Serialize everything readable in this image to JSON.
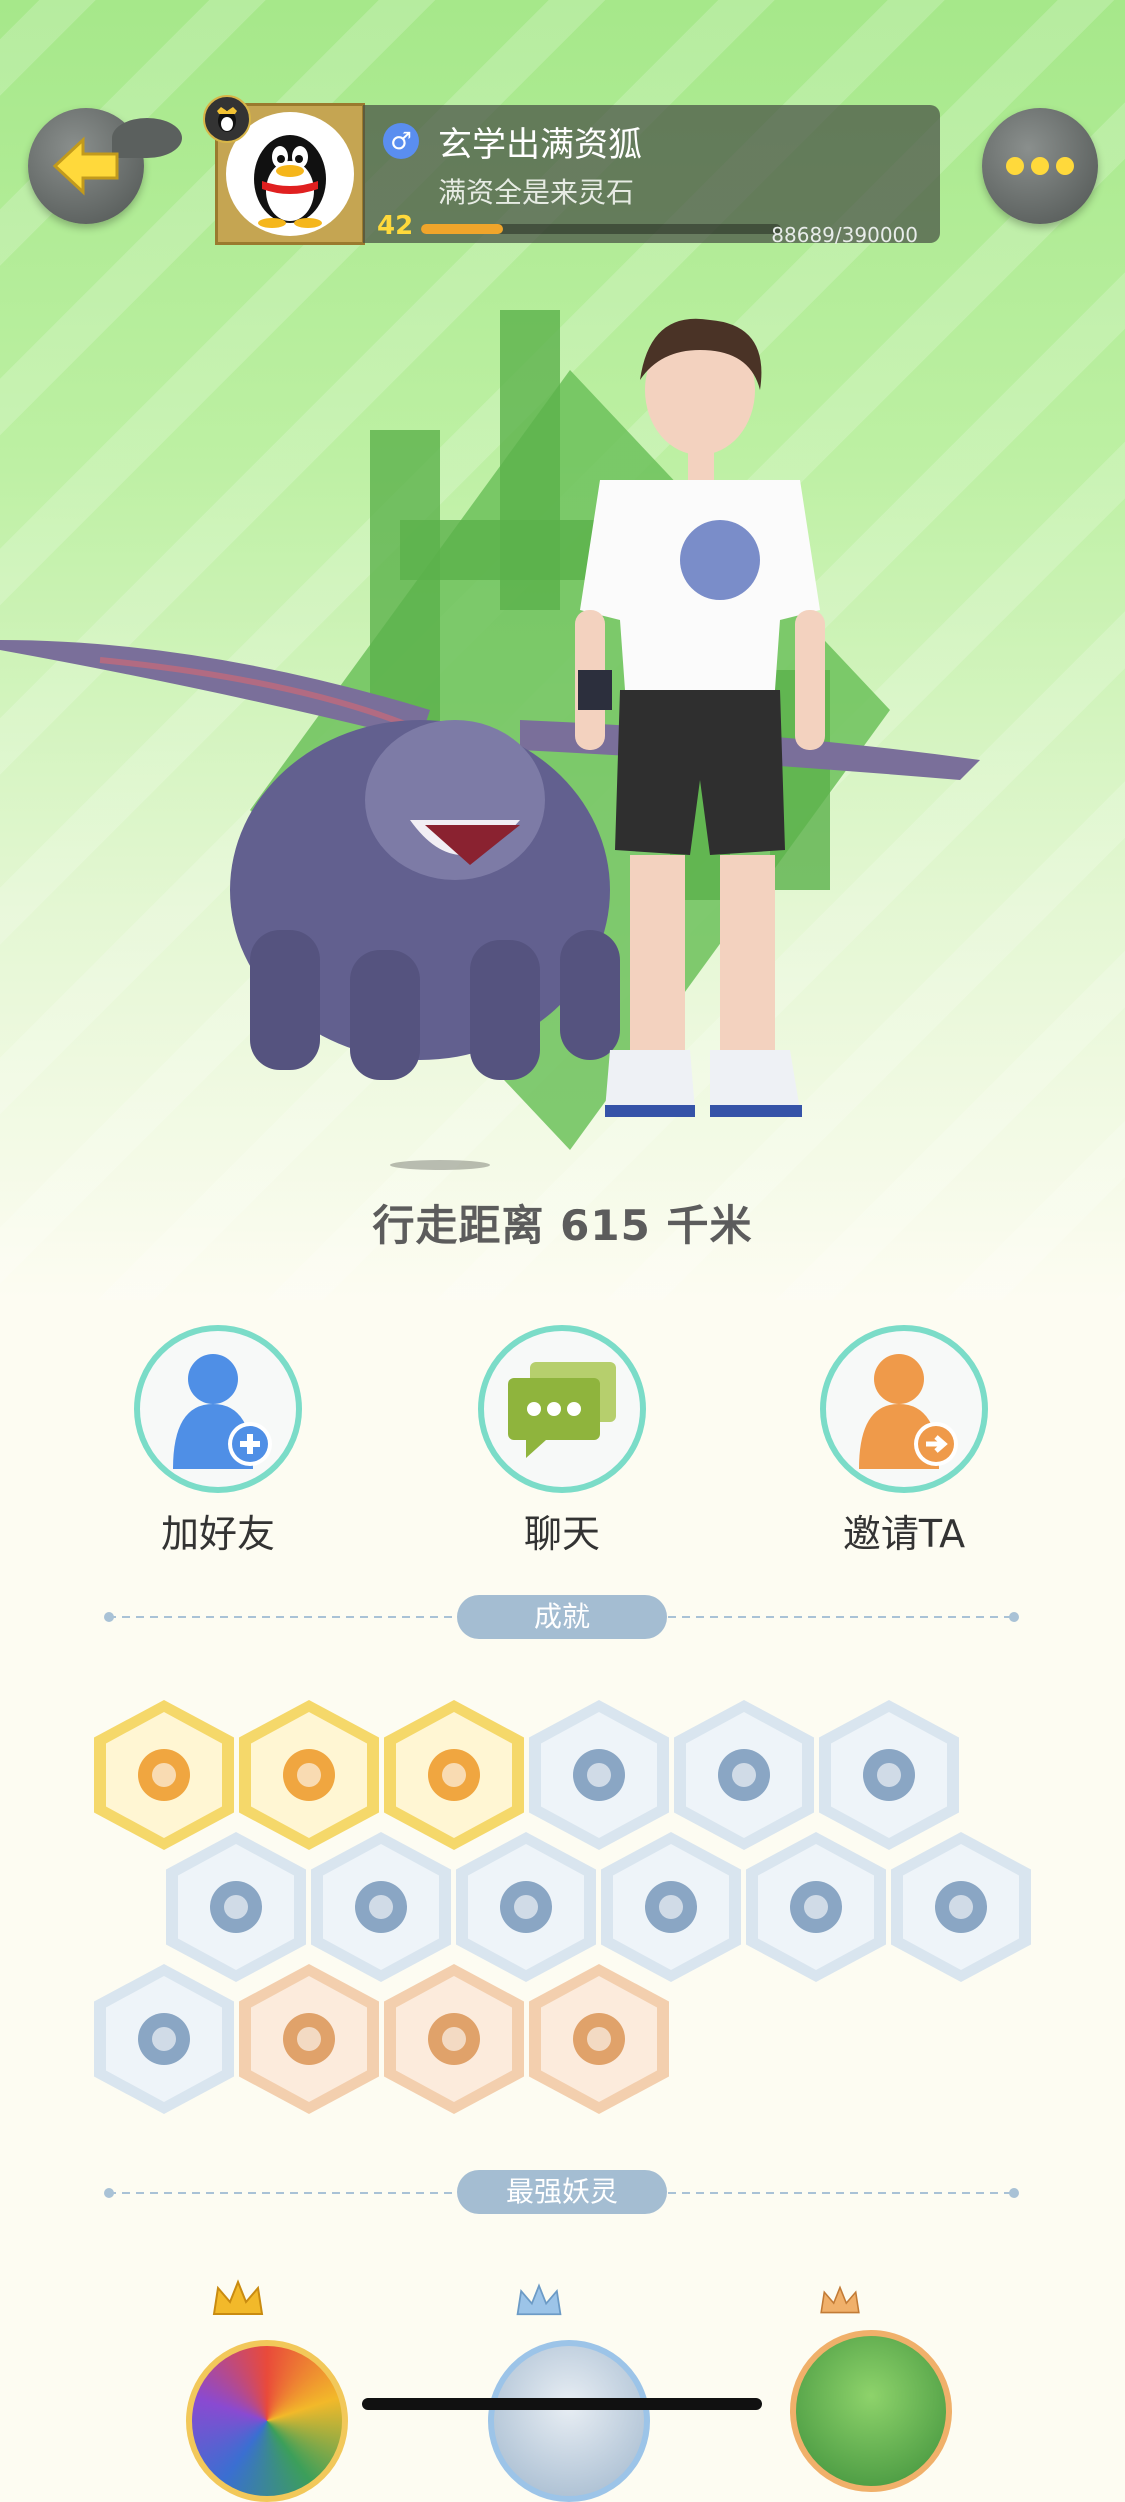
{
  "profile": {
    "nickname": "玄学出满资狐",
    "signature": "满资全是来灵石",
    "gender_symbol": "♂",
    "level": "42",
    "exp_text": "88689/390000",
    "exp_fraction": 0.227
  },
  "stats": {
    "distance_text": "行走距离 615 千米"
  },
  "actions": [
    {
      "label": "加好友",
      "icon": "add-friend-icon"
    },
    {
      "label": "聊天",
      "icon": "chat-icon"
    },
    {
      "label": "邀请TA",
      "icon": "invite-icon"
    }
  ],
  "sections": {
    "achievements_title": "成就",
    "strongest_title": "最强妖灵"
  },
  "achievements": [
    {
      "icon": "fox-moon-badge-icon",
      "tier": "gold"
    },
    {
      "icon": "gourd-badge-icon",
      "tier": "gold"
    },
    {
      "icon": "crescent-coin-badge-icon",
      "tier": "gold"
    },
    {
      "icon": "sneaker-badge-icon",
      "tier": "silver"
    },
    {
      "icon": "compass-pin-badge-icon",
      "tier": "silver"
    },
    {
      "icon": "crystal-badge-icon",
      "tier": "silver"
    },
    {
      "icon": "spirit-figure-badge-icon",
      "tier": "silver"
    },
    {
      "icon": "stroller-badge-icon",
      "tier": "silver"
    },
    {
      "icon": "cat-spirit-badge-icon",
      "tier": "silver"
    },
    {
      "icon": "yin-yang-badge-icon",
      "tier": "silver"
    },
    {
      "icon": "fish-spirit-badge-icon",
      "tier": "silver"
    },
    {
      "icon": "scroll-badge-icon",
      "tier": "silver"
    },
    {
      "icon": "ghost-cat-badge-icon",
      "tier": "silver"
    },
    {
      "icon": "moon-orb-badge-icon",
      "tier": "bronze"
    },
    {
      "icon": "horned-spirit-badge-icon",
      "tier": "bronze"
    },
    {
      "icon": "fox-book-badge-icon",
      "tier": "bronze"
    }
  ],
  "colors": {
    "gold_tier": "#f5d86a",
    "silver_tier": "#d9e5ef",
    "bronze_tier": "#f3cfae",
    "accent_teal": "#7bdcc8"
  }
}
